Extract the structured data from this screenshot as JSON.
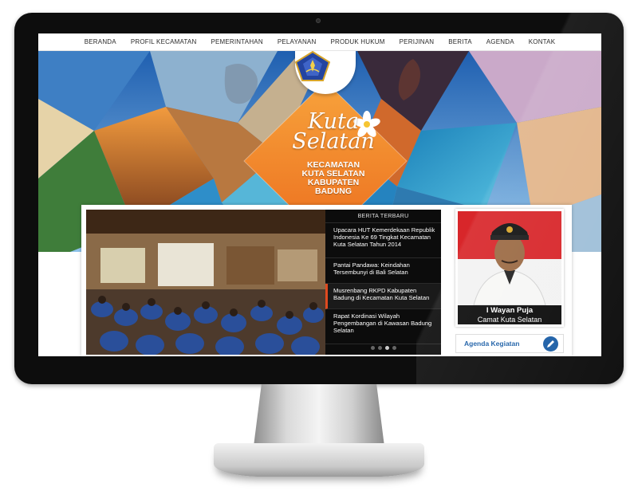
{
  "nav": {
    "items": [
      "BERANDA",
      "PROFIL KECAMATAN",
      "PEMERINTAHAN",
      "PELAYANAN",
      "PRODUK HUKUM",
      "PERIJINAN",
      "BERITA",
      "AGENDA",
      "KONTAK"
    ]
  },
  "banner": {
    "title_line1": "Kuta",
    "title_line2": "Selatan",
    "subtitle_line1": "KECAMATAN",
    "subtitle_line2": "KUTA SELATAN",
    "subtitle_line3": "KABUPATEN",
    "subtitle_line4": "BADUNG"
  },
  "news": {
    "header": "BERITA TERBARU",
    "items": [
      "Upacara HUT Kemerdekaan Republik Indonesia Ke 69 Tingkat Kecamatan Kuta Selatan Tahun 2014",
      "Pantai Pandawa: Keindahan Tersembunyi di Bali Selatan",
      "Musrenbang RKPD Kabupaten Badung di Kecamatan Kuta Selatan",
      "Rapat Kordinasi Wilayah Pengembangan di Kawasan Badung Selatan"
    ],
    "active_index": 2
  },
  "profile": {
    "name": "I Wayan Puja",
    "role": "Camat Kuta Selatan"
  },
  "agenda": {
    "label": "Agenda Kegiatan",
    "icon": "edit-icon"
  },
  "colors": {
    "accent_orange": "#f0892a",
    "accent_blue": "#1b5ea6",
    "news_bg": "#0c0c0c",
    "active_marker": "#e04a1f"
  }
}
